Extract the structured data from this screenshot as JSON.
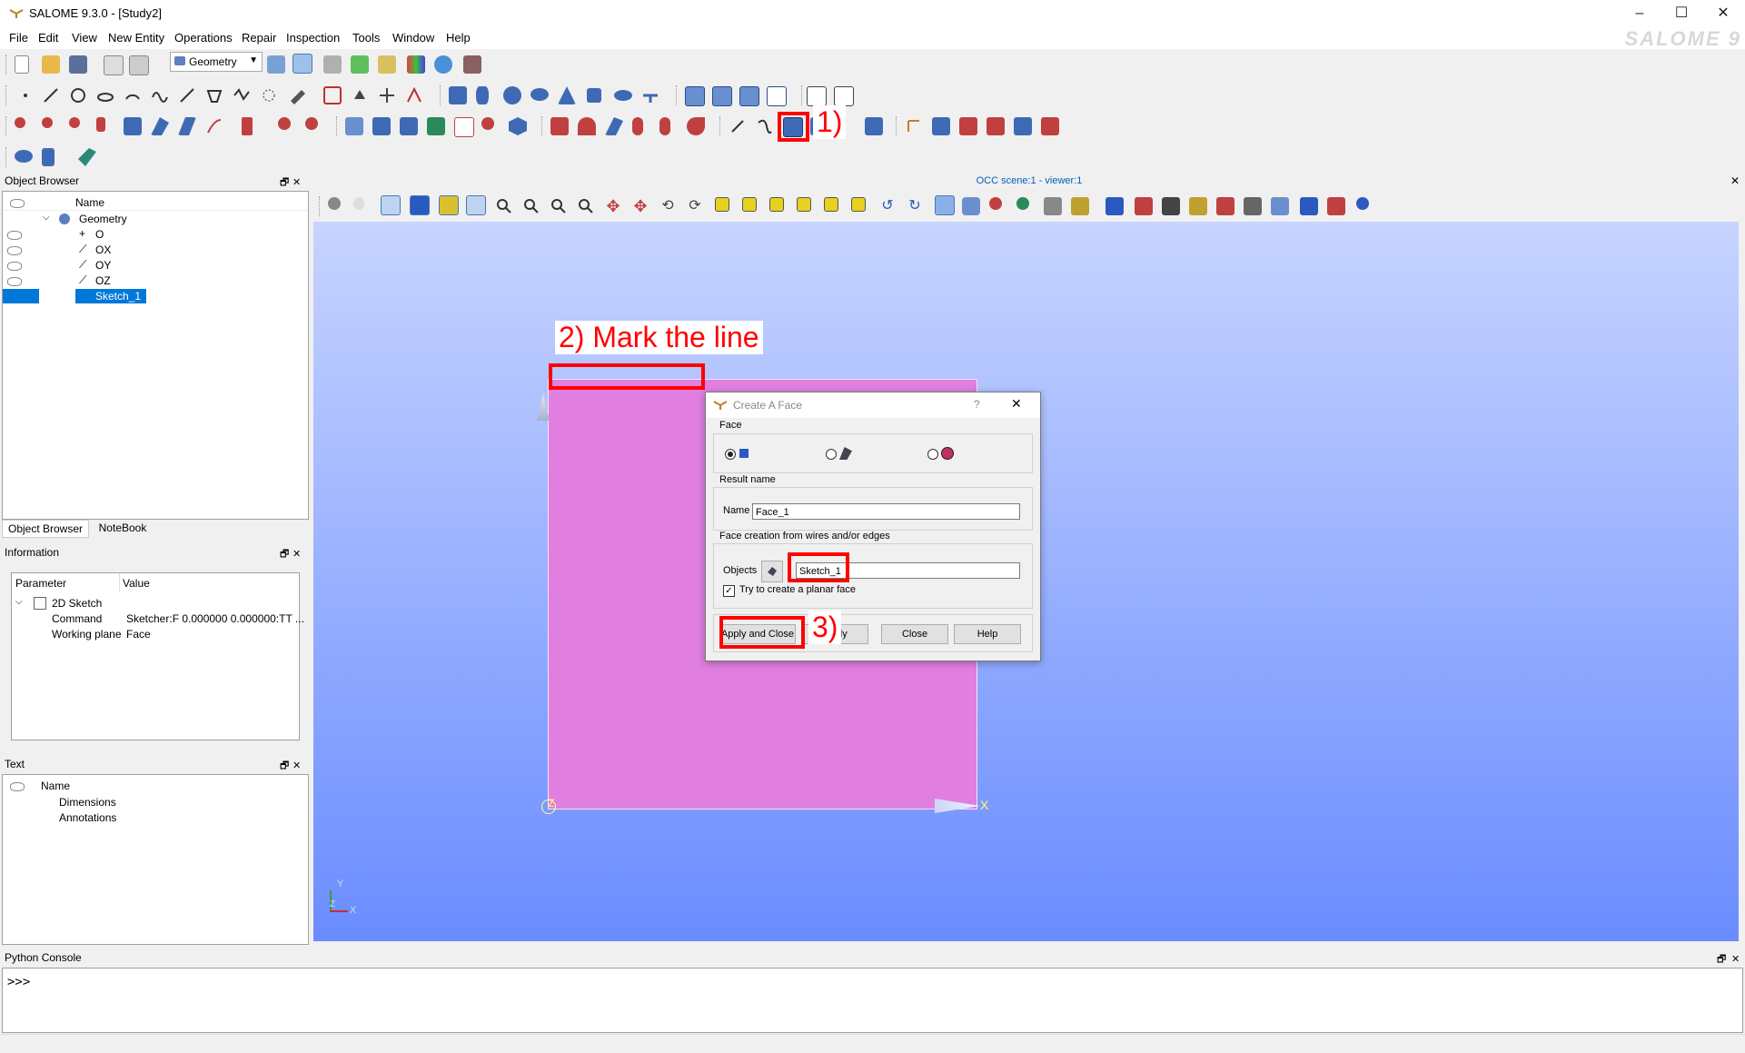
{
  "window": {
    "title": "SALOME 9.3.0 - [Study2]",
    "brand": "SALOME 9"
  },
  "menu": [
    "File",
    "Edit",
    "View",
    "New Entity",
    "Operations",
    "Repair",
    "Inspection",
    "Tools",
    "Window",
    "Help"
  ],
  "toolbar": {
    "module": "Geometry"
  },
  "object_browser": {
    "title": "Object Browser",
    "column": "Name",
    "root": "Geometry",
    "items": [
      "O",
      "OX",
      "OY",
      "OZ",
      "Sketch_1"
    ],
    "selected": "Sketch_1",
    "tabs": [
      "Object Browser",
      "NoteBook"
    ]
  },
  "information": {
    "title": "Information",
    "columns": [
      "Parameter",
      "Value"
    ],
    "group": "2D Sketch",
    "rows": [
      {
        "param": "Command",
        "value": "Sketcher:F 0.000000 0.000000:TT ..."
      },
      {
        "param": "Working plane",
        "value": "Face"
      }
    ]
  },
  "text_panel": {
    "title": "Text",
    "column": "Name",
    "items": [
      "Dimensions",
      "Annotations"
    ]
  },
  "viewer": {
    "title": "OCC scene:1 - viewer:1",
    "axis_x": "X",
    "axis_y": "Y",
    "axis_z": "Z"
  },
  "dialog": {
    "title": "Create A Face",
    "help_q": "?",
    "face_group": "Face",
    "result_group": "Result name",
    "name_label": "Name",
    "name_value": "Face_1",
    "creation_group": "Face creation from wires and/or edges",
    "objects_label": "Objects",
    "objects_value": "Sketch_1",
    "planar_label": "Try to create a planar face",
    "buttons": {
      "apply_close": "Apply and Close",
      "apply": "Apply",
      "close": "Close",
      "help": "Help"
    }
  },
  "annotations": {
    "a1": "1)",
    "a2": "2) Mark the line",
    "a3": "3)"
  },
  "console": {
    "title": "Python Console",
    "prompt": ">>>"
  },
  "colors": {
    "selection": "#0078d7",
    "face": "#e07fe0",
    "annotation": "#ff0000"
  }
}
